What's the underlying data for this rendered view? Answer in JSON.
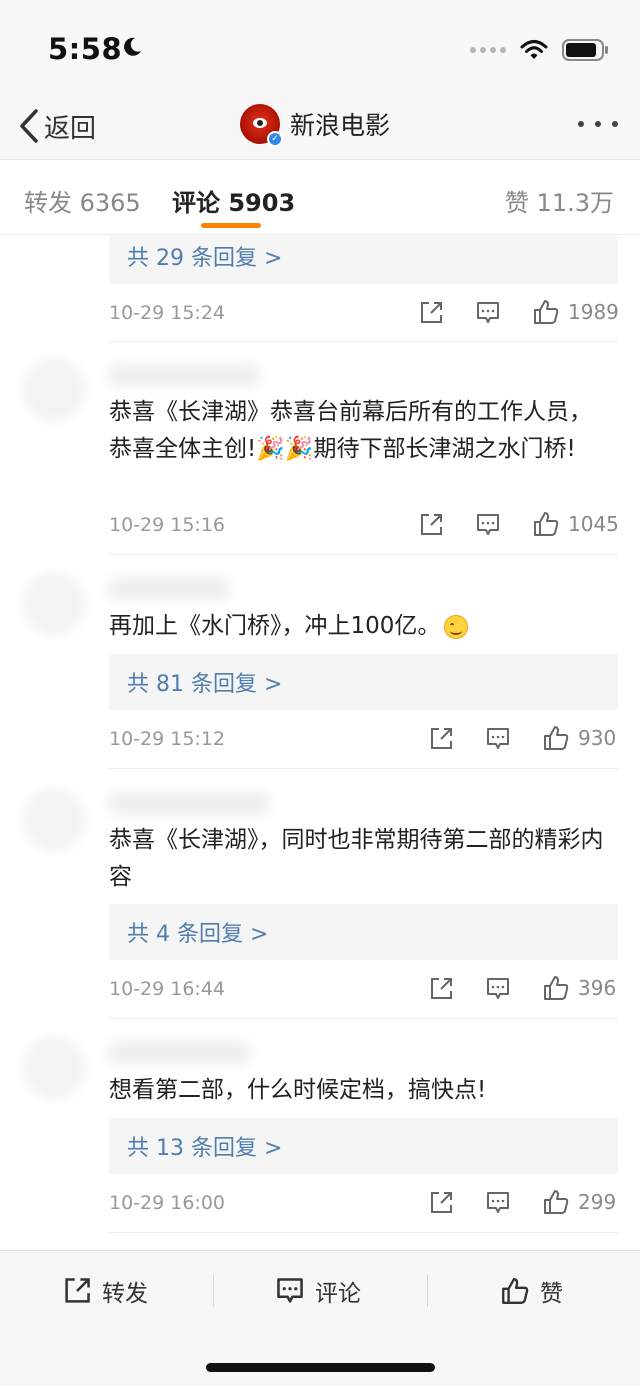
{
  "status_bar": {
    "time": "5:58"
  },
  "nav": {
    "back_label": "返回",
    "title": "新浪电影"
  },
  "tabs": {
    "repost": "转发 6365",
    "comment": "评论 5903",
    "like": "赞 11.3万"
  },
  "comments": [
    {
      "text": "",
      "reply_label": "共 29 条回复 >",
      "time": "10-29 15:24",
      "likes": "1989"
    },
    {
      "text": "恭喜《长津湖》恭喜台前幕后所有的工作人员，恭喜全体主创!🎉🎉期待下部长津湖之水门桥!",
      "reply_label": "",
      "time": "10-29 15:16",
      "likes": "1045"
    },
    {
      "text": "再加上《水门桥》，冲上100亿。",
      "reply_label": "共 81 条回复 >",
      "time": "10-29 15:12",
      "likes": "930"
    },
    {
      "text": "恭喜《长津湖》，同时也非常期待第二部的精彩内容",
      "reply_label": "共 4 条回复 >",
      "time": "10-29 16:44",
      "likes": "396"
    },
    {
      "text": "想看第二部，什么时候定档，搞快点!",
      "reply_label": "共 13 条回复 >",
      "time": "10-29 16:00",
      "likes": "299"
    }
  ],
  "bottom_bar": {
    "repost": "转发",
    "comment": "评论",
    "like": "赞"
  },
  "colors": {
    "accent": "#ff8200",
    "link": "#507daf",
    "verified": "#2e8ae6"
  },
  "icons": [
    "moon-icon",
    "wifi-icon",
    "battery-icon",
    "back-chevron-icon",
    "more-icon",
    "share-icon",
    "comment-icon",
    "thumb-up-icon"
  ]
}
